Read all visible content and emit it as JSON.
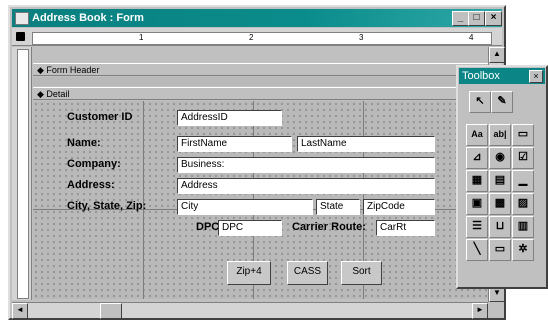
{
  "window": {
    "title": "Address Book : Form",
    "minimize": "_",
    "maximize": "□",
    "close": "×"
  },
  "ruler": {
    "marks": [
      "1",
      "2",
      "3",
      "4"
    ]
  },
  "sections": {
    "form_header": "Form Header",
    "detail": "Detail"
  },
  "fields": {
    "customer_id": {
      "label": "Customer ID",
      "box": "AddressID"
    },
    "name": {
      "label": "Name:",
      "first": "FirstName",
      "last": "LastName"
    },
    "company": {
      "label": "Company:",
      "box": "Business:"
    },
    "address": {
      "label": "Address:",
      "box": "Address"
    },
    "city_state_zip": {
      "label": "City, State, Zip:",
      "city": "City",
      "state": "State",
      "zip": "ZipCode"
    },
    "dpc": {
      "label": "DPC:",
      "box": "DPC"
    },
    "carrier_route": {
      "label": "Carrier Route:",
      "box": "CarRt"
    }
  },
  "buttons": {
    "zip4": "Zip+4",
    "cass": "CASS",
    "sort": "Sort"
  },
  "toolbox": {
    "title": "Toolbox",
    "close": "×",
    "tools": [
      "select-pointer",
      "control-wizards",
      "label",
      "text-box",
      "option-group",
      "toggle-button",
      "option-button",
      "check-box",
      "combo-box",
      "list-box",
      "command-button",
      "image",
      "unbound-object-frame",
      "bound-object-frame",
      "page-break",
      "tab-control",
      "subform",
      "line",
      "rectangle",
      "more-controls"
    ],
    "glyphs": {
      "label": "Aa",
      "text_box": "ab|"
    }
  }
}
